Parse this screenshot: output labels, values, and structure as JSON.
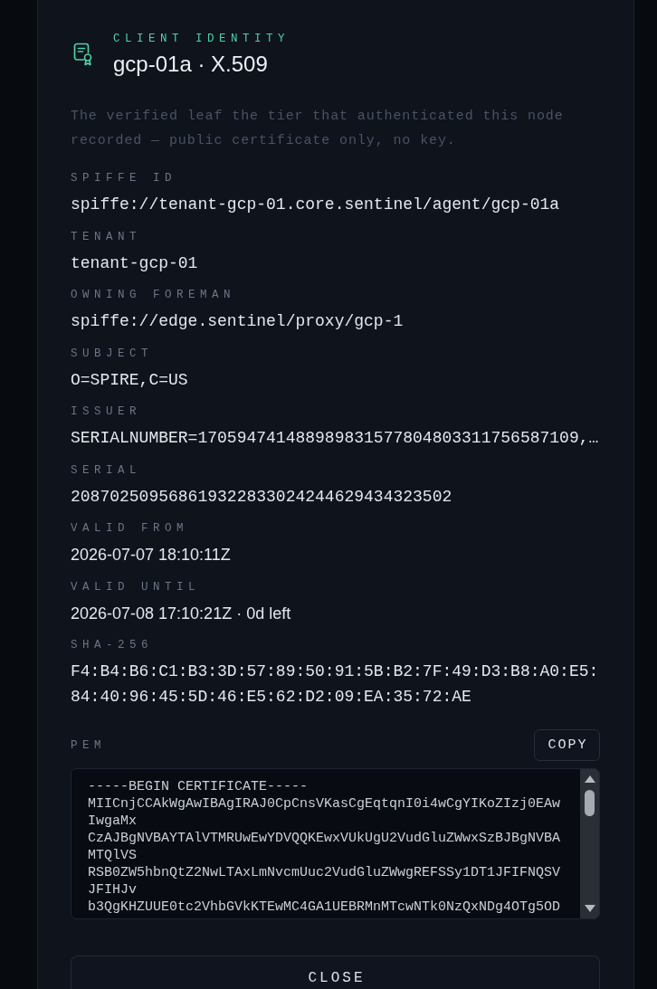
{
  "dialog": {
    "eyebrow": "CLIENT IDENTITY",
    "title": "gcp-01a · X.509",
    "description": "The verified leaf the tier that authenticated this node recorded — public certificate only, no key.",
    "fields": [
      {
        "label": "SPIFFE ID",
        "value": "spiffe://tenant-gcp-01.core.sentinel/agent/gcp-01a",
        "kind": "code"
      },
      {
        "label": "TENANT",
        "value": "tenant-gcp-01",
        "kind": "code"
      },
      {
        "label": "OWNING FOREMAN",
        "value": "spiffe://edge.sentinel/proxy/gcp-1",
        "kind": "code"
      },
      {
        "label": "SUBJECT",
        "value": "O=SPIRE,C=US",
        "kind": "code"
      },
      {
        "label": "ISSUER",
        "value": "SERIALNUMBER=170594741488989831577804803311756587109,…",
        "kind": "code"
      },
      {
        "label": "SERIAL",
        "value": "208702509568619322833024244629434323502",
        "kind": "code"
      },
      {
        "label": "VALID FROM",
        "value": "2026-07-07 18:10:11Z",
        "kind": "date"
      },
      {
        "label": "VALID UNTIL",
        "value": "2026-07-08 17:10:21Z · 0d left",
        "kind": "date"
      },
      {
        "label": "SHA-256",
        "value": "F4:B4:B6:C1:B3:3D:57:89:50:91:5B:B2:7F:49:D3:B8:A0:E5:84:40:96:45:5D:46:E5:62:D2:09:EA:35:72:AE",
        "kind": "code"
      }
    ],
    "pem": {
      "label": "PEM",
      "copy_button": "COPY",
      "value": "-----BEGIN CERTIFICATE-----\nMIICnjCCAkWgAwIBAgIRAJ0CpCnsVKasCgEqtqnI0i4wCgYIKoZIzj0EAwIwgaMx\nCzAJBgNVBAYTAlVTMRUwEwYDVQQKEwxVUkUgU2VudGluZWwxSzBJBgNVBAMTQlVS\nRSB0ZW5hbnQtZ2NwLTAxLmNvcmUuc2VudGluZWwgREFSSy1DT1JFIFNQSVJFIHJv\nb3QgKHZUUE0tc2VhbGVkKTEwMC4GA1UEBRMnMTcwNTk0NzQxNDg4OTg5OD"
    },
    "close_button": "CLOSE"
  }
}
